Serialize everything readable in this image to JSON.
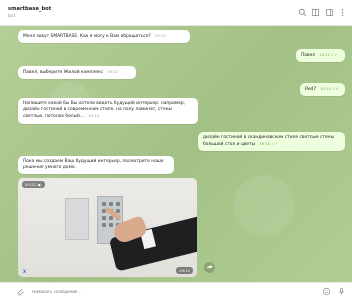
{
  "header": {
    "title": "smartbase_bot",
    "subtitle": "bot",
    "icons": [
      "search-icon",
      "columns-icon",
      "sidebar-icon",
      "more-icon"
    ]
  },
  "messages": [
    {
      "text": "Меня зовут SMARTBASE. Как я могу к Вам обращаться?",
      "time": "19:12",
      "dir": "in"
    },
    {
      "text": "Павел",
      "time": "19:12",
      "dir": "out"
    },
    {
      "text": "Павел, выберите Жилой комплекс",
      "time": "19:12",
      "dir": "in"
    },
    {
      "text": "Red7",
      "time": "19:12",
      "dir": "out"
    },
    {
      "text": "Напишите какой бы Вы хотели видеть будущий интерьер: например, дизайн гостиной в современном стиле, на полу ламинат, стены светлые, потолок белый...",
      "time": "19:12",
      "dir": "in"
    },
    {
      "text": "дизайн гостиной в скандинавском стиле светлые стены большой стол и цветы",
      "time": "19:12",
      "dir": "out"
    },
    {
      "text": "Пока мы создаем Ваш будущий интерьер, посмотрите наше решение умного дома.",
      "dir": "in"
    }
  ],
  "video": {
    "duration": "00:22",
    "time": "19:12",
    "logo": "X"
  },
  "composer": {
    "placeholder": "Написать сообщение..."
  }
}
